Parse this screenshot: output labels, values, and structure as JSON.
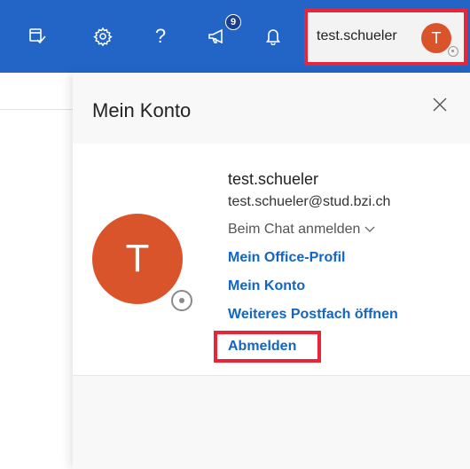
{
  "topbar": {
    "icons": [
      "calendar-check-icon",
      "gear-icon",
      "help-icon",
      "megaphone-icon",
      "bell-icon"
    ],
    "help_label": "?",
    "whatsnew_badge": "9",
    "user": {
      "name": "test.schueler",
      "initial": "T"
    }
  },
  "panel": {
    "title": "Mein Konto",
    "close_icon": "close-icon",
    "user": {
      "initial": "T",
      "name": "test.schueler",
      "email": "test.schueler@stud.bzi.ch",
      "chat_status": "Beim Chat anmelden"
    },
    "links": {
      "office_profile": "Mein Office-Profil",
      "account": "Mein Konto",
      "other_mailbox": "Weiteres Postfach öffnen",
      "sign_out": "Abmelden"
    }
  },
  "colors": {
    "topbar": "#2265c7",
    "avatar": "#d9542b",
    "link": "#1265c5",
    "highlight": "#e8263a"
  }
}
